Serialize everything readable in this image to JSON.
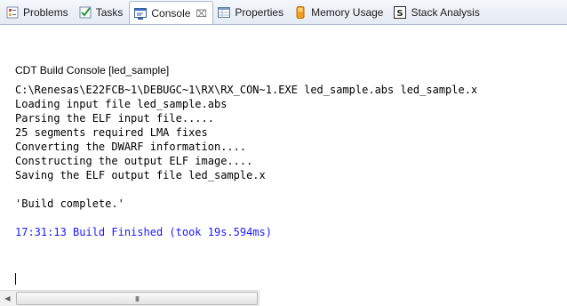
{
  "tabs": [
    {
      "label": "Problems",
      "icon": "problems-icon"
    },
    {
      "label": "Tasks",
      "icon": "tasks-icon"
    },
    {
      "label": "Console",
      "icon": "console-icon",
      "active": true,
      "close": "⌧"
    },
    {
      "label": "Properties",
      "icon": "properties-icon"
    },
    {
      "label": "Memory Usage",
      "icon": "memory-usage-icon"
    },
    {
      "label": "Stack Analysis",
      "icon": "stack-analysis-icon"
    }
  ],
  "console": {
    "title": "CDT Build Console [led_sample]",
    "lines": [
      "C:\\Renesas\\E22FCB~1\\DEBUGC~1\\RX\\RX_CON~1.EXE led_sample.abs led_sample.x",
      "Loading input file led_sample.abs",
      "Parsing the ELF input file.....",
      "25 segments required LMA fixes",
      "Converting the DWARF information....",
      "Constructing the output ELF image....",
      "Saving the ELF output file led_sample.x",
      "",
      "'Build complete.'",
      "",
      "17:31:13 Build Finished (took 19s.594ms)"
    ],
    "finished_line_color": "#1a1aff"
  },
  "scrollbar": {
    "left_arrow": "◀",
    "grip": "III"
  }
}
